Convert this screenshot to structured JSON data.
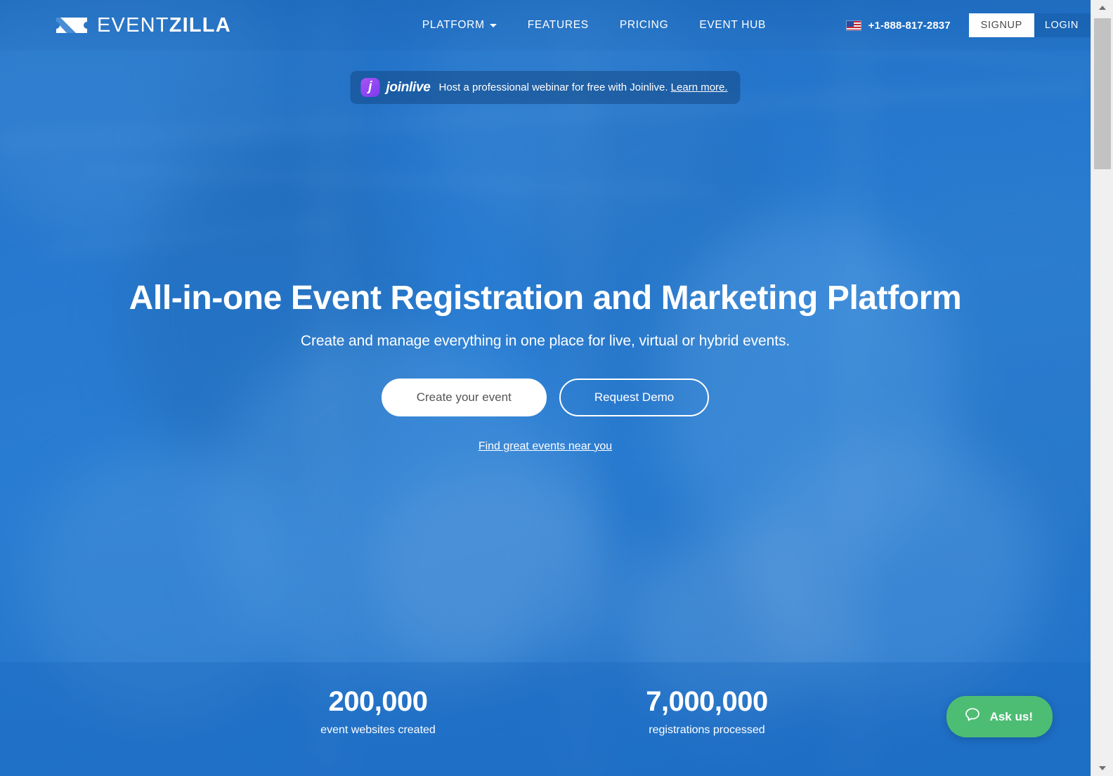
{
  "brand": {
    "name_light": "EVENT",
    "name_bold": "ZILLA",
    "logo_icon": "ticket-icon"
  },
  "nav": {
    "links": [
      {
        "label": "PLATFORM",
        "has_dropdown": true
      },
      {
        "label": "FEATURES",
        "has_dropdown": false
      },
      {
        "label": "PRICING",
        "has_dropdown": false
      },
      {
        "label": "EVENT HUB",
        "has_dropdown": false
      }
    ],
    "flag_icon": "us-flag-icon",
    "phone": "+1-888-817-2837",
    "signup_label": "SIGNUP",
    "login_label": "LOGIN"
  },
  "promo": {
    "badge_letter": "j",
    "wordmark": "joinlive",
    "message": "Host a professional webinar for free with Joinlive.",
    "link_label": "Learn more.",
    "background_color": "#154682"
  },
  "hero": {
    "title": "All-in-one Event Registration and Marketing Platform",
    "subtitle": "Create and manage everything in one place for live, virtual or hybrid events.",
    "primary_cta": "Create your event",
    "secondary_cta": "Request Demo",
    "find_events_link": "Find great events near you",
    "overlay_color": "#2176d2"
  },
  "stats": [
    {
      "number": "200,000",
      "label": "event websites created"
    },
    {
      "number": "7,000,000",
      "label": "registrations processed"
    }
  ],
  "chat": {
    "label": "Ask us!",
    "icon": "chat-bubble-icon",
    "color": "#4dbd74"
  },
  "scrollbar": {
    "up_arrow": "scroll-up-arrow-icon",
    "down_arrow": "scroll-down-arrow-icon"
  }
}
